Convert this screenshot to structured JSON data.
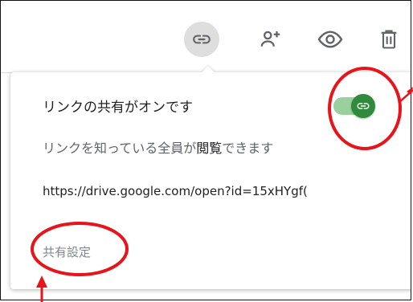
{
  "toolbar": {
    "icons": [
      "link-icon",
      "add-person-icon",
      "preview-icon",
      "trash-icon"
    ],
    "active_color": "#dedede",
    "icon_color": "#5f6368"
  },
  "share_popover": {
    "title": "リンクの共有がオンです",
    "access_prefix": "リンクを知っている全員が",
    "access_level": "閲覧",
    "access_suffix": "できます",
    "link_url": "https://drive.google.com/open?id=15xHYgf(",
    "settings_link": "共有設定",
    "toggle_state": "on",
    "toggle_color": "#2f8a3b"
  },
  "annotations": {
    "circle_color": "#e8141b",
    "arrow_color": "#e8141b"
  }
}
